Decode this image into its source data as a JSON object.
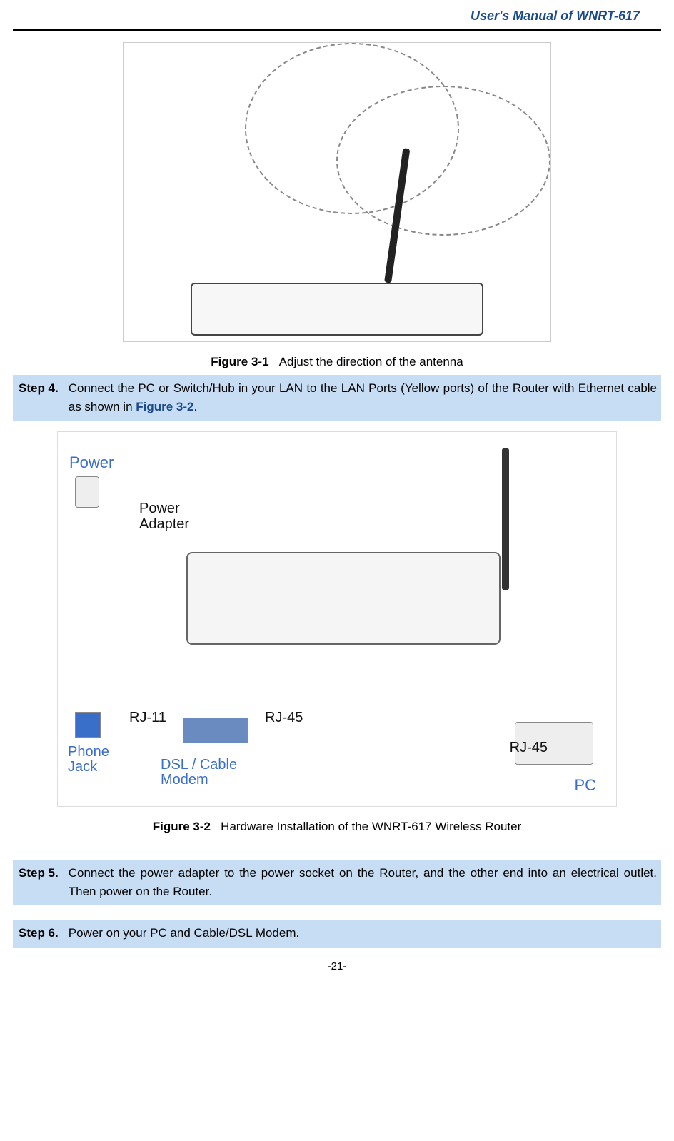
{
  "header": {
    "title": "User's  Manual  of  WNRT-617"
  },
  "figures": {
    "fig1": {
      "label": "Figure 3-1",
      "caption": "Adjust the direction of the antenna",
      "alt": "[Illustration: hand rotating router antenna with dashed motion ellipses]"
    },
    "fig2": {
      "label": "Figure 3-2",
      "caption": "Hardware Installation of the WNRT-617 Wireless Router",
      "alt": "[Diagram: Power adapter → Router; Phone Jack ↔ RJ-11 ↔ DSL/Cable Modem ↔ RJ-45 ↔ Router WAN; Router LAN ↔ RJ-45 ↔ PC]",
      "labels": {
        "power": "Power",
        "power_adapter_l1": "Power",
        "power_adapter_l2": "Adapter",
        "rj11": "RJ-11",
        "rj45": "RJ-45",
        "phone_l1": "Phone",
        "phone_l2": "Jack",
        "modem_l1": "DSL / Cable",
        "modem_l2": "Modem",
        "pc": "PC"
      }
    }
  },
  "steps": {
    "s4": {
      "label": "Step 4.",
      "text_pre": "Connect the PC or Switch/Hub in your LAN to the LAN Ports (Yellow ports) of the Router with Ethernet cable as shown in ",
      "link": "Figure 3-2",
      "text_post": "."
    },
    "s5": {
      "label": "Step 5.",
      "text": "Connect the power adapter to the power socket on the Router, and the other end into an electrical outlet. Then power on the Router."
    },
    "s6": {
      "label": "Step 6.",
      "text": "Power on your PC and Cable/DSL Modem."
    }
  },
  "page_number": "-21-"
}
